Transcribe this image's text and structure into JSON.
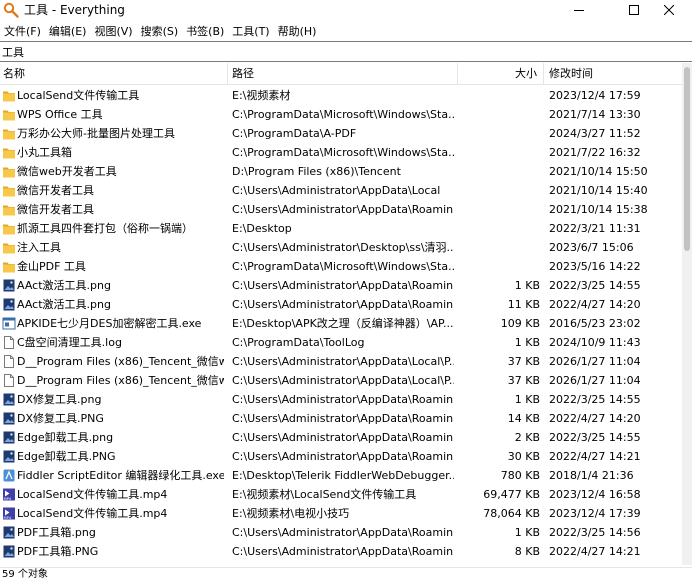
{
  "window": {
    "title": "工具 - Everything"
  },
  "menu": [
    "文件(F)",
    "编辑(E)",
    "视图(V)",
    "搜索(S)",
    "书签(B)",
    "工具(T)",
    "帮助(H)"
  ],
  "search": {
    "value": "工具"
  },
  "columns": {
    "name": "名称",
    "path": "路径",
    "size": "大小",
    "date": "修改时间"
  },
  "rows": [
    {
      "icon": "folder-icon",
      "name": "LocalSend文件传输工具",
      "path": "E:\\视频素材",
      "size": "",
      "date": "2023/12/4 17:59"
    },
    {
      "icon": "folder-icon",
      "name": "WPS Office 工具",
      "path": "C:\\ProgramData\\Microsoft\\Windows\\Sta...",
      "size": "",
      "date": "2021/7/14 13:30"
    },
    {
      "icon": "folder-icon",
      "name": "万彩办公大师-批量图片处理工具",
      "path": "C:\\ProgramData\\A-PDF",
      "size": "",
      "date": "2024/3/27 11:52"
    },
    {
      "icon": "folder-icon",
      "name": "小丸工具箱",
      "path": "C:\\ProgramData\\Microsoft\\Windows\\Sta...",
      "size": "",
      "date": "2021/7/22 16:32"
    },
    {
      "icon": "folder-icon",
      "name": "微信web开发者工具",
      "path": "D:\\Program Files (x86)\\Tencent",
      "size": "",
      "date": "2021/10/14 15:50"
    },
    {
      "icon": "folder-icon",
      "name": "微信开发者工具",
      "path": "C:\\Users\\Administrator\\AppData\\Local",
      "size": "",
      "date": "2021/10/14 15:40"
    },
    {
      "icon": "folder-icon",
      "name": "微信开发者工具",
      "path": "C:\\Users\\Administrator\\AppData\\Roamin...",
      "size": "",
      "date": "2021/10/14 15:38"
    },
    {
      "icon": "folder-icon",
      "name": "抓源工具四件套打包（俗称一锅端）",
      "path": "E:\\Desktop",
      "size": "",
      "date": "2022/3/21 11:31"
    },
    {
      "icon": "folder-icon",
      "name": "注入工具",
      "path": "C:\\Users\\Administrator\\Desktop\\ss\\清羽...",
      "size": "",
      "date": "2023/6/7 15:06"
    },
    {
      "icon": "folder-icon",
      "name": "金山PDF 工具",
      "path": "C:\\ProgramData\\Microsoft\\Windows\\Sta...",
      "size": "",
      "date": "2023/5/16 14:22"
    },
    {
      "icon": "png-icon",
      "name": "AAct激活工具.png",
      "path": "C:\\Users\\Administrator\\AppData\\Roamin...",
      "size": "1 KB",
      "date": "2022/3/25 14:55"
    },
    {
      "icon": "png-icon",
      "name": "AAct激活工具.png",
      "path": "C:\\Users\\Administrator\\AppData\\Roamin...",
      "size": "11 KB",
      "date": "2022/4/27 14:20"
    },
    {
      "icon": "exe-icon",
      "name": "APKIDE七少月DES加密解密工具.exe",
      "path": "E:\\Desktop\\APK改之理（反编译神器）\\AP...",
      "size": "109 KB",
      "date": "2016/5/23 23:02"
    },
    {
      "icon": "file-icon",
      "name": "C盘空间清理工具.log",
      "path": "C:\\ProgramData\\ToolLog",
      "size": "1 KB",
      "date": "2024/10/9 11:43"
    },
    {
      "icon": "file-icon",
      "name": "D__Program Files (x86)_Tencent_微信w...",
      "path": "C:\\Users\\Administrator\\AppData\\Local\\P...",
      "size": "37 KB",
      "date": "2026/1/27 11:04"
    },
    {
      "icon": "file-icon",
      "name": "D__Program Files (x86)_Tencent_微信w...",
      "path": "C:\\Users\\Administrator\\AppData\\Local\\P...",
      "size": "37 KB",
      "date": "2026/1/27 11:04"
    },
    {
      "icon": "png-icon",
      "name": "DX修复工具.png",
      "path": "C:\\Users\\Administrator\\AppData\\Roamin...",
      "size": "1 KB",
      "date": "2022/3/25 14:55"
    },
    {
      "icon": "png-icon",
      "name": "DX修复工具.PNG",
      "path": "C:\\Users\\Administrator\\AppData\\Roamin...",
      "size": "14 KB",
      "date": "2022/4/27 14:20"
    },
    {
      "icon": "png-icon",
      "name": "Edge卸载工具.png",
      "path": "C:\\Users\\Administrator\\AppData\\Roamin...",
      "size": "2 KB",
      "date": "2022/3/25 14:55"
    },
    {
      "icon": "png-icon",
      "name": "Edge卸载工具.PNG",
      "path": "C:\\Users\\Administrator\\AppData\\Roamin...",
      "size": "30 KB",
      "date": "2022/4/27 14:21"
    },
    {
      "icon": "fiddler-icon",
      "name": "Fiddler ScriptEditor 编辑器绿化工具.exe",
      "path": "E:\\Desktop\\Telerik FiddlerWebDebugger...",
      "size": "780 KB",
      "date": "2018/1/4 21:36"
    },
    {
      "icon": "mp4-icon",
      "name": "LocalSend文件传输工具.mp4",
      "path": "E:\\视频素材\\LocalSend文件传输工具",
      "size": "69,477 KB",
      "date": "2023/12/4 16:58"
    },
    {
      "icon": "mp4-icon",
      "name": "LocalSend文件传输工具.mp4",
      "path": "E:\\视频素材\\电视小技巧",
      "size": "78,064 KB",
      "date": "2023/12/4 17:39"
    },
    {
      "icon": "png-icon",
      "name": "PDF工具箱.png",
      "path": "C:\\Users\\Administrator\\AppData\\Roamin...",
      "size": "1 KB",
      "date": "2022/3/25 14:56"
    },
    {
      "icon": "png-icon",
      "name": "PDF工具箱.PNG",
      "path": "C:\\Users\\Administrator\\AppData\\Roamin...",
      "size": "8 KB",
      "date": "2022/4/27 14:21"
    }
  ],
  "status": {
    "text": "59 个对象"
  },
  "colors": {
    "folder": "#f7c948",
    "folder_dark": "#e5a823",
    "png": "#1e3a6e",
    "mp4": "#3f3fa8"
  }
}
